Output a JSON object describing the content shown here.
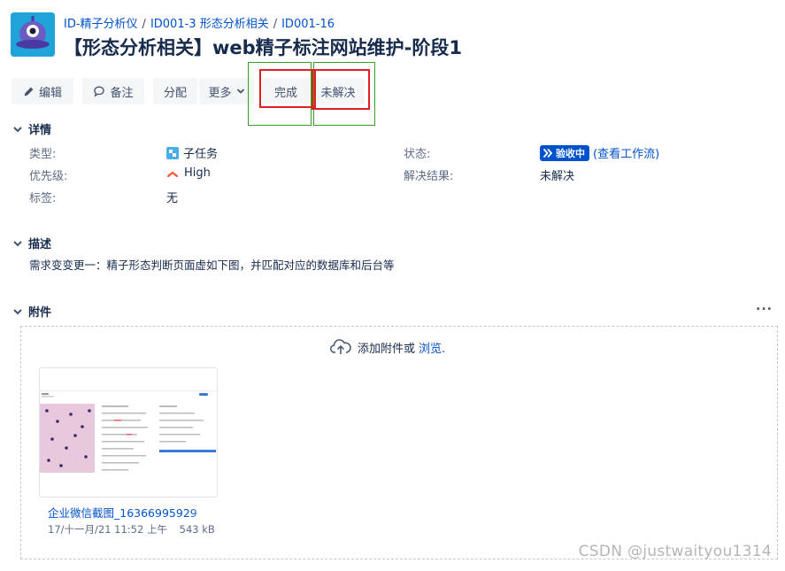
{
  "breadcrumb": [
    "ID-精子分析仪",
    "ID001-3 形态分析相关",
    "ID001-16"
  ],
  "issue_title": "【形态分析相关】web精子标注网站维护-阶段1",
  "toolbar": {
    "edit": "编辑",
    "comment": "备注",
    "assign": "分配",
    "more": "更多",
    "done": "完成",
    "unresolved": "未解决"
  },
  "details": {
    "heading": "详情",
    "type_label": "类型:",
    "type_value": "子任务",
    "priority_label": "优先级:",
    "priority_value": "High",
    "labels_label": "标签:",
    "labels_value": "无",
    "status_label": "状态:",
    "status_value": "验收中",
    "workflow_link": "(查看工作流)",
    "resolution_label": "解决结果:",
    "resolution_value": "未解决"
  },
  "description": {
    "heading": "描述",
    "text": "需求变变更一：精子形态判断页面虚如下图，并匹配对应的数据库和后台等"
  },
  "attachments": {
    "heading": "附件",
    "more": "...",
    "add_text": "添加附件或",
    "browse": "浏览.",
    "file_name": "企业微信截图_16366995929",
    "file_date": "17/十一月/21 11:52 上午",
    "file_size": "543 kB"
  },
  "watermark": "CSDN @justwaityou1314",
  "colors": {
    "link": "#0052cc",
    "status": "#0052cc",
    "priority": "#ff5630",
    "highlight_red": "#e02020",
    "highlight_green": "#3a9a2a"
  }
}
